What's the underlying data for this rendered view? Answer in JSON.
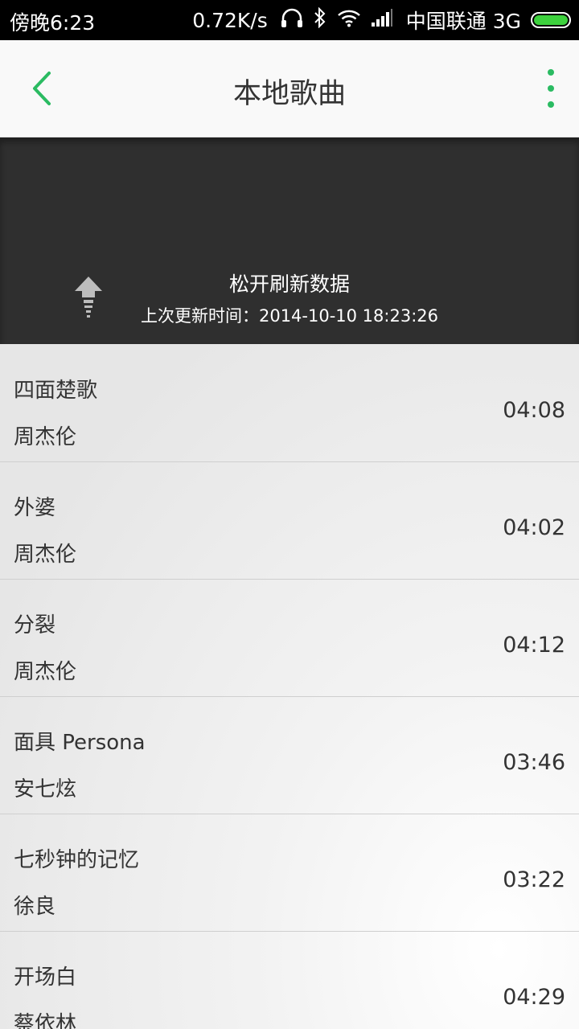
{
  "status_bar": {
    "time": "傍晚6:23",
    "speed": "0.72K/s",
    "carrier": "中国联通 3G",
    "icons": [
      "headphones-icon",
      "bluetooth-icon",
      "wifi-icon",
      "signal-icon",
      "battery-icon"
    ],
    "battery_color": "#3dd13d"
  },
  "header": {
    "title": "本地歌曲",
    "accent_color": "#2bbb62"
  },
  "refresh": {
    "title": "松开刷新数据",
    "last_update": "上次更新时间：2014-10-10 18:23:26"
  },
  "songs": [
    {
      "title": "四面楚歌",
      "artist": "周杰伦",
      "duration": "04:08"
    },
    {
      "title": "外婆",
      "artist": "周杰伦",
      "duration": "04:02"
    },
    {
      "title": "分裂",
      "artist": "周杰伦",
      "duration": "04:12"
    },
    {
      "title": "面具 Persona",
      "artist": "安七炫",
      "duration": "03:46"
    },
    {
      "title": "七秒钟的记忆",
      "artist": "徐良",
      "duration": "03:22"
    },
    {
      "title": "开场白",
      "artist": "蔡依林",
      "duration": "04:29"
    }
  ]
}
